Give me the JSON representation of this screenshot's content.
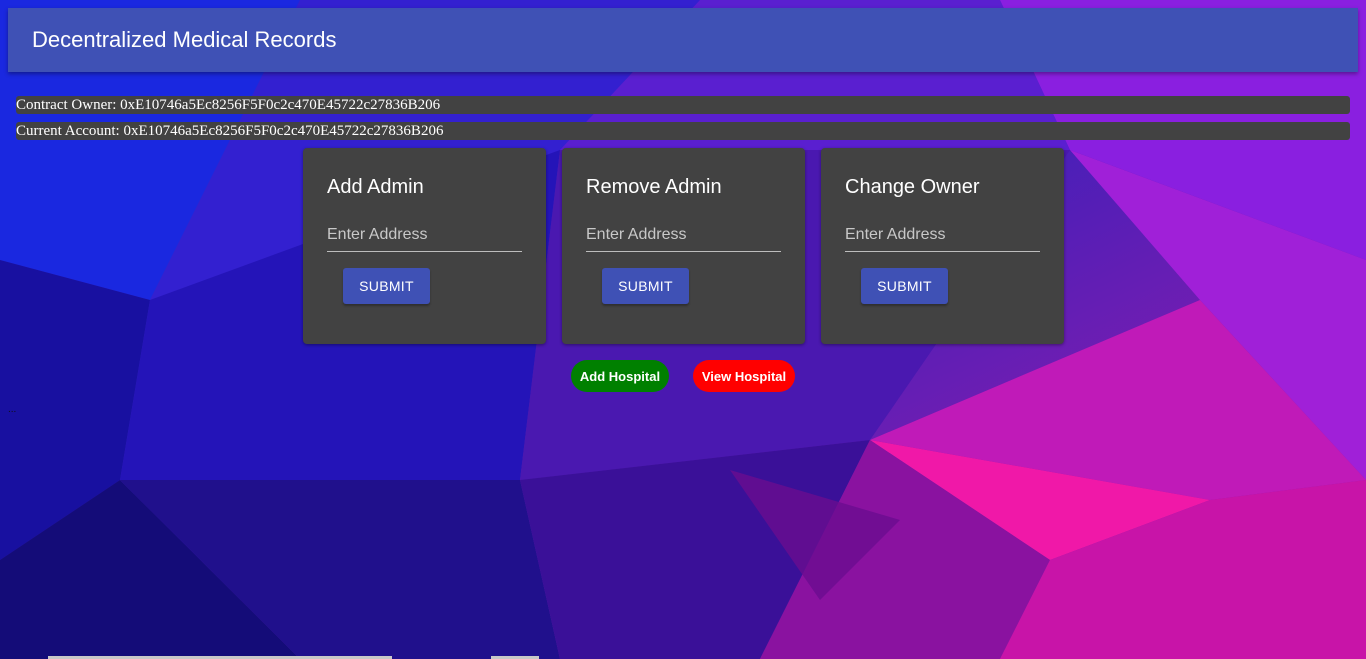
{
  "appbar": {
    "title": "Decentralized Medical Records"
  },
  "info": {
    "contract_owner": "Contract Owner: 0xE10746a5Ec8256F5F0c2c470E45722c27836B206",
    "current_account": "Current Account: 0xE10746a5Ec8256F5F0c2c470E45722c27836B206"
  },
  "cards": [
    {
      "title": "Add Admin",
      "placeholder": "Enter Address",
      "submit_label": "SUBMIT"
    },
    {
      "title": "Remove Admin",
      "placeholder": "Enter Address",
      "submit_label": "SUBMIT"
    },
    {
      "title": "Change Owner",
      "placeholder": "Enter Address",
      "submit_label": "SUBMIT"
    }
  ],
  "actions": {
    "add_hospital": "Add Hospital",
    "view_hospital": "View Hospital"
  },
  "colors": {
    "appbar": "#3f51b5",
    "card": "#424242",
    "submit": "#3f51b5",
    "add_hospital": "#008000",
    "view_hospital": "#ff0000"
  },
  "misc": {
    "dots": "..."
  }
}
